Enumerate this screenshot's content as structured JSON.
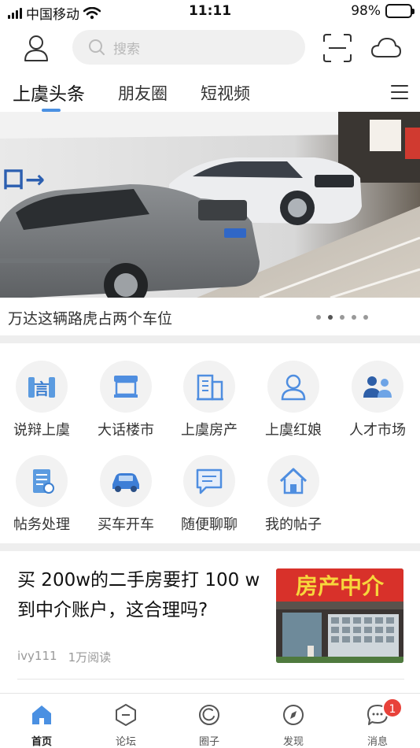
{
  "status_bar": {
    "carrier": "中国移动",
    "time": "11:11",
    "battery": "98%",
    "battery_level": 0.98,
    "icons": [
      "signal-icon",
      "wifi-icon",
      "battery-charging-icon"
    ]
  },
  "header": {
    "search_placeholder": "搜索",
    "icons": [
      "user-icon",
      "search-icon",
      "scan-icon",
      "cloud-icon"
    ]
  },
  "tabs": [
    {
      "label": "上虞头条",
      "active": true
    },
    {
      "label": "朋友圈",
      "active": false
    },
    {
      "label": "短视频",
      "active": false
    }
  ],
  "banner": {
    "caption": "万达这辆路虎占两个车位",
    "slide_count": 5,
    "active_slide": 2
  },
  "grid": [
    {
      "label": "说辩上虞",
      "icon": "debate-icon"
    },
    {
      "label": "大话楼市",
      "icon": "kiosk-icon"
    },
    {
      "label": "上虞房产",
      "icon": "building-icon"
    },
    {
      "label": "上虞红娘",
      "icon": "people-icon"
    },
    {
      "label": "人才市场",
      "icon": "business-people-icon"
    },
    {
      "label": "帖务处理",
      "icon": "document-icon"
    },
    {
      "label": "买车开车",
      "icon": "car-icon"
    },
    {
      "label": "随便聊聊",
      "icon": "chat-icon"
    },
    {
      "label": "我的帖子",
      "icon": "house-icon"
    }
  ],
  "article": {
    "title": "买 200w的二手房要打 100 w到中介账户，这合理吗?",
    "author": "ivy111",
    "reads": "1万阅读",
    "thumb_sign": "房产中介"
  },
  "tabbar": [
    {
      "label": "首页",
      "icon": "home-icon",
      "active": true
    },
    {
      "label": "论坛",
      "icon": "forum-icon",
      "active": false
    },
    {
      "label": "圈子",
      "icon": "circle-icon",
      "active": false
    },
    {
      "label": "发现",
      "icon": "discover-icon",
      "active": false
    },
    {
      "label": "消息",
      "icon": "message-icon",
      "active": false,
      "badge": "1"
    }
  ],
  "colors": {
    "accent": "#4a90e2",
    "badge": "#e8423a",
    "battery_fill": "#3cc53c"
  }
}
